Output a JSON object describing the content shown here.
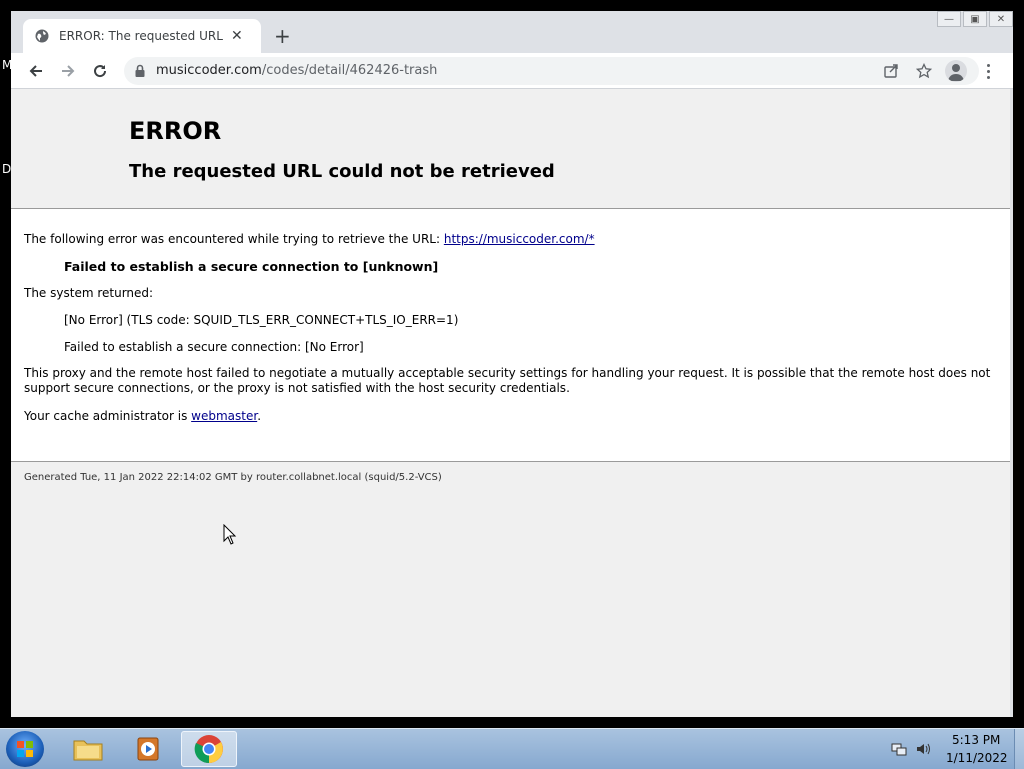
{
  "desktop": {
    "edge_letters": [
      "M",
      "D"
    ]
  },
  "browser": {
    "tab": {
      "title": "ERROR: The requested URL could not be retrieved"
    },
    "url": {
      "host": "musiccoder.com",
      "path": "/codes/detail/462426-trash"
    }
  },
  "page": {
    "title": "ERROR",
    "subtitle": "The requested URL could not be retrieved",
    "intro_text": "The following error was encountered while trying to retrieve the URL: ",
    "intro_link": "https://musiccoder.com/*",
    "failure_heading": "Failed to establish a secure connection to [unknown]",
    "system_returned_label": "The system returned:",
    "tls_code": "[No Error] (TLS code: SQUID_TLS_ERR_CONNECT+TLS_IO_ERR=1)",
    "secure_connection_error": "Failed to establish a secure connection: [No Error]",
    "explanation": "This proxy and the remote host failed to negotiate a mutually acceptable security settings for handling your request. It is possible that the remote host does not support secure connections, or the proxy is not satisfied with the host security credentials.",
    "admin_prefix": "Your cache administrator is ",
    "admin_link": "webmaster",
    "admin_suffix": ".",
    "footer": "Generated Tue, 11 Jan 2022 22:14:02 GMT by router.collabnet.local (squid/5.2-VCS)"
  },
  "taskbar": {
    "time": "5:13 PM",
    "date": "1/11/2022"
  }
}
